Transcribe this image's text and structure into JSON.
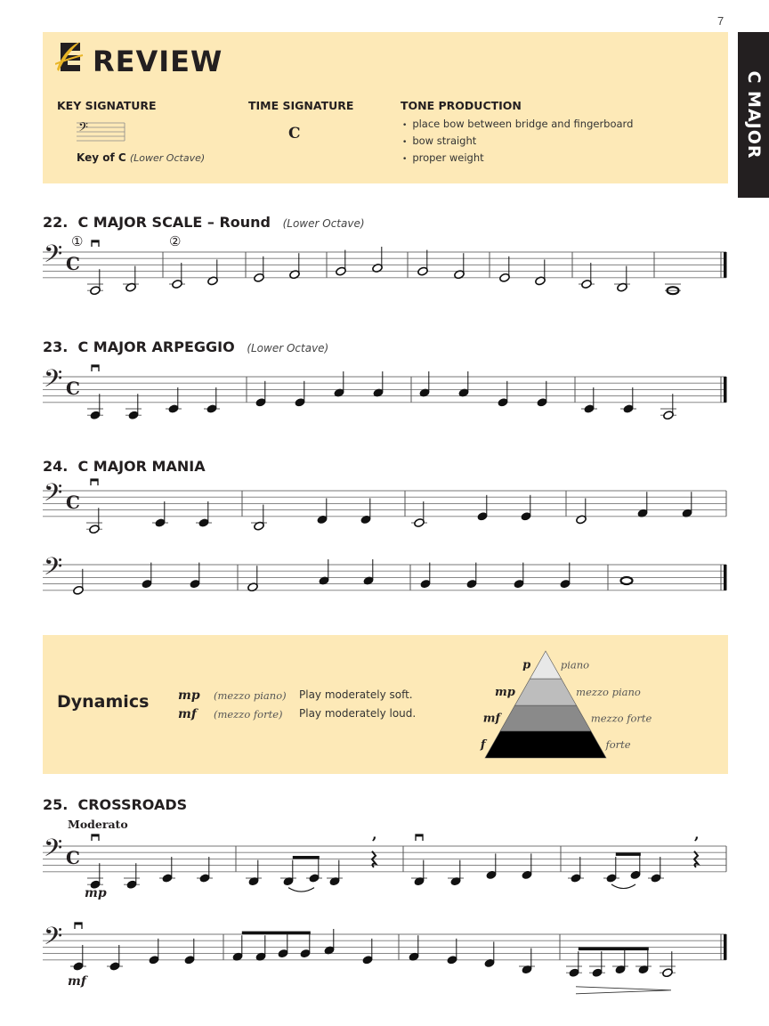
{
  "page": {
    "number": "7",
    "side_tab": "C MAJOR"
  },
  "review": {
    "title": "REVIEW",
    "key_signature": {
      "heading": "KEY SIGNATURE",
      "caption": "Key of C",
      "caption_note": "(Lower Octave)"
    },
    "time_signature": {
      "heading": "TIME SIGNATURE",
      "symbol": "C"
    },
    "tone_production": {
      "heading": "TONE PRODUCTION",
      "items": [
        "place bow between bridge and fingerboard",
        "bow straight",
        "proper weight"
      ]
    }
  },
  "exercises": [
    {
      "number": "22.",
      "title": "C MAJOR SCALE – Round",
      "subtitle": "(Lower Octave)",
      "round_markers": [
        "①",
        "②"
      ],
      "staves": [
        {
          "clef": "bass",
          "time": "C",
          "final": true,
          "measures": [
            [
              {
                "p": "C2",
                "d": "h",
                "bow": "down"
              },
              {
                "p": "D2",
                "d": "h"
              }
            ],
            [
              {
                "p": "E2",
                "d": "h"
              },
              {
                "p": "F2",
                "d": "h"
              }
            ],
            [
              {
                "p": "G2",
                "d": "h"
              },
              {
                "p": "A2",
                "d": "h"
              }
            ],
            [
              {
                "p": "B2",
                "d": "h"
              },
              {
                "p": "C3",
                "d": "h"
              }
            ],
            [
              {
                "p": "B2",
                "d": "h"
              },
              {
                "p": "A2",
                "d": "h"
              }
            ],
            [
              {
                "p": "G2",
                "d": "h"
              },
              {
                "p": "F2",
                "d": "h"
              }
            ],
            [
              {
                "p": "E2",
                "d": "h"
              },
              {
                "p": "D2",
                "d": "h"
              }
            ],
            [
              {
                "p": "C2",
                "d": "w"
              }
            ]
          ]
        }
      ]
    },
    {
      "number": "23.",
      "title": "C MAJOR ARPEGGIO",
      "subtitle": "(Lower Octave)",
      "staves": [
        {
          "clef": "bass",
          "time": "C",
          "final": true,
          "measures": [
            [
              {
                "p": "C2",
                "d": "q",
                "bow": "down"
              },
              {
                "p": "C2",
                "d": "q"
              },
              {
                "p": "E2",
                "d": "q"
              },
              {
                "p": "E2",
                "d": "q"
              }
            ],
            [
              {
                "p": "G2",
                "d": "q"
              },
              {
                "p": "G2",
                "d": "q"
              },
              {
                "p": "C3",
                "d": "q"
              },
              {
                "p": "C3",
                "d": "q"
              }
            ],
            [
              {
                "p": "C3",
                "d": "q"
              },
              {
                "p": "C3",
                "d": "q"
              },
              {
                "p": "G2",
                "d": "q"
              },
              {
                "p": "G2",
                "d": "q"
              }
            ],
            [
              {
                "p": "E2",
                "d": "q"
              },
              {
                "p": "E2",
                "d": "q"
              },
              {
                "p": "C2",
                "d": "h"
              }
            ]
          ]
        }
      ]
    },
    {
      "number": "24.",
      "title": "C MAJOR MANIA",
      "subtitle": "",
      "staves": [
        {
          "clef": "bass",
          "time": "C",
          "final": false,
          "measures": [
            [
              {
                "p": "C2",
                "d": "h",
                "bow": "down"
              },
              {
                "p": "E2",
                "d": "q"
              },
              {
                "p": "E2",
                "d": "q"
              }
            ],
            [
              {
                "p": "D2",
                "d": "h"
              },
              {
                "p": "F2",
                "d": "q"
              },
              {
                "p": "F2",
                "d": "q"
              }
            ],
            [
              {
                "p": "E2",
                "d": "h"
              },
              {
                "p": "G2",
                "d": "q"
              },
              {
                "p": "G2",
                "d": "q"
              }
            ],
            [
              {
                "p": "F2",
                "d": "h"
              },
              {
                "p": "A2",
                "d": "q"
              },
              {
                "p": "A2",
                "d": "q"
              }
            ]
          ]
        },
        {
          "clef": "bass",
          "time": "",
          "final": true,
          "measures": [
            [
              {
                "p": "G2",
                "d": "h"
              },
              {
                "p": "B2",
                "d": "q"
              },
              {
                "p": "B2",
                "d": "q"
              }
            ],
            [
              {
                "p": "A2",
                "d": "h"
              },
              {
                "p": "C3",
                "d": "q"
              },
              {
                "p": "C3",
                "d": "q"
              }
            ],
            [
              {
                "p": "B2",
                "d": "q"
              },
              {
                "p": "B2",
                "d": "q"
              },
              {
                "p": "B2",
                "d": "q"
              },
              {
                "p": "B2",
                "d": "q"
              }
            ],
            [
              {
                "p": "C3",
                "d": "w"
              }
            ]
          ]
        }
      ]
    },
    {
      "number": "25.",
      "title": "CROSSROADS",
      "subtitle": "",
      "tempo": "Moderato",
      "staves": [
        {
          "clef": "bass",
          "time": "C",
          "final": false,
          "dynamic": "mp",
          "measures": [
            [
              {
                "p": "C2",
                "d": "q",
                "bow": "down"
              },
              {
                "p": "C2",
                "d": "q"
              },
              {
                "p": "E2",
                "d": "q"
              },
              {
                "p": "E2",
                "d": "q"
              }
            ],
            [
              {
                "p": "D2",
                "d": "q"
              },
              {
                "p": "D2",
                "d": "e",
                "beam": "start",
                "slur": "start"
              },
              {
                "p": "E2",
                "d": "e",
                "beam": "end",
                "slur": "end"
              },
              {
                "p": "D2",
                "d": "q"
              },
              {
                "p": "rest",
                "d": "q",
                "breath": true
              }
            ],
            [
              {
                "p": "D2",
                "d": "q",
                "bow": "down"
              },
              {
                "p": "D2",
                "d": "q"
              },
              {
                "p": "F2",
                "d": "q"
              },
              {
                "p": "F2",
                "d": "q"
              }
            ],
            [
              {
                "p": "E2",
                "d": "q"
              },
              {
                "p": "E2",
                "d": "e",
                "beam": "start",
                "slur": "start"
              },
              {
                "p": "F2",
                "d": "e",
                "beam": "end",
                "slur": "end"
              },
              {
                "p": "E2",
                "d": "q"
              },
              {
                "p": "rest",
                "d": "q",
                "breath": true
              }
            ]
          ]
        },
        {
          "clef": "bass",
          "time": "",
          "final": true,
          "dynamic": "mf",
          "measures": [
            [
              {
                "p": "E2",
                "d": "q",
                "bow": "down"
              },
              {
                "p": "E2",
                "d": "q"
              },
              {
                "p": "G2",
                "d": "q"
              },
              {
                "p": "G2",
                "d": "q"
              }
            ],
            [
              {
                "p": "A2",
                "d": "e",
                "beam": "start"
              },
              {
                "p": "A2",
                "d": "e"
              },
              {
                "p": "B2",
                "d": "e"
              },
              {
                "p": "B2",
                "d": "e",
                "beam": "end"
              },
              {
                "p": "C3",
                "d": "q"
              },
              {
                "p": "G2",
                "d": "q"
              }
            ],
            [
              {
                "p": "A2",
                "d": "q"
              },
              {
                "p": "G2",
                "d": "q"
              },
              {
                "p": "F2",
                "d": "q"
              },
              {
                "p": "D2",
                "d": "q"
              }
            ],
            [
              {
                "p": "C2",
                "d": "e",
                "beam": "start"
              },
              {
                "p": "C2",
                "d": "e"
              },
              {
                "p": "D2",
                "d": "e"
              },
              {
                "p": "D2",
                "d": "e",
                "beam": "end"
              },
              {
                "p": "C2",
                "d": "h"
              }
            ]
          ],
          "decrescendo_measure": 4
        }
      ]
    }
  ],
  "dynamics": {
    "title": "Dynamics",
    "rows": [
      {
        "symbol": "mp",
        "name": "(mezzo piano)",
        "meaning": "Play moderately soft."
      },
      {
        "symbol": "mf",
        "name": "(mezzo forte)",
        "meaning": "Play moderately loud."
      }
    ],
    "pyramid": [
      {
        "symbol": "p",
        "label": "piano",
        "color": "#e8e8e8"
      },
      {
        "symbol": "mp",
        "label": "mezzo piano",
        "color": "#bdbdbd"
      },
      {
        "symbol": "mf",
        "label": "mezzo forte",
        "color": "#8a8a8a"
      },
      {
        "symbol": "f",
        "label": "forte",
        "color": "#000000"
      }
    ]
  },
  "colors": {
    "box_background": "#fde9b7",
    "tab_background": "#231f20",
    "logo_gold": "#e9b526"
  }
}
